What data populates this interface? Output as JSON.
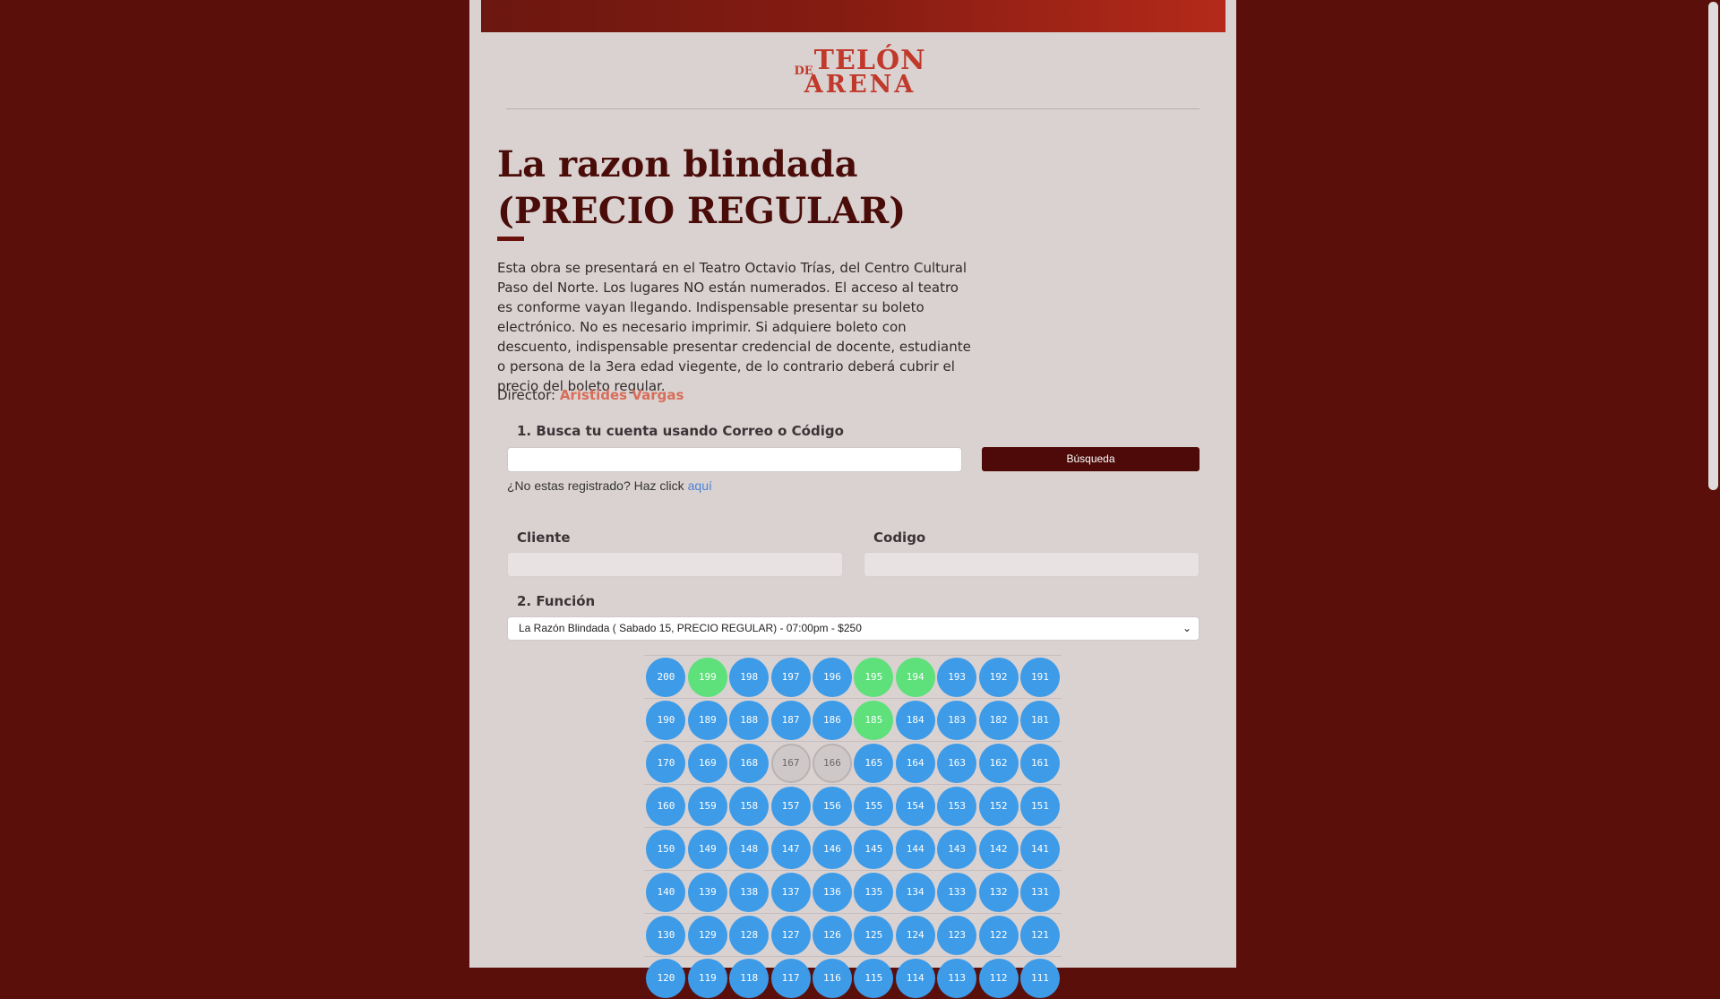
{
  "logo": {
    "de": "DE",
    "telon": "TELÓN",
    "arena": "ARENA"
  },
  "event": {
    "title": "La razon blindada (PRECIO REGULAR)",
    "description": "Esta obra se presentará en el Teatro Octavio Trías, del Centro Cultural Paso del Norte. Los lugares NO están numerados. El acceso al teatro es conforme vayan llegando. Indispensable presentar su boleto electrónico. No es necesario imprimir. Si adquiere boleto con descuento, indispensable presentar credencial de docente, estudiante o persona de la 3era edad viegente, de lo contrario deberá cubrir el precio del boleto regular.",
    "director_label": "Director:",
    "director_name": "Aristides Vargas"
  },
  "search": {
    "label": "1. Busca tu cuenta usando Correo o Código",
    "input_value": "",
    "button_label": "Búsqueda",
    "register_text": "¿No estas registrado? Haz click",
    "register_link": "aquí"
  },
  "client": {
    "cliente_label": "Cliente",
    "cliente_value": "",
    "codigo_label": "Codigo",
    "codigo_value": ""
  },
  "funcion": {
    "label": "2. Función",
    "selected": "La Razón Blindada ( Sabado 15, PRECIO REGULAR) - 07:00pm - $250"
  },
  "seat_legend_colors": {
    "available": "#3d9be8",
    "selected": "#5ee07a",
    "unavailable": "#cfc8c8"
  },
  "seats": {
    "rows": [
      [
        "200",
        "199",
        "198",
        "197",
        "196",
        "195",
        "194",
        "193",
        "192",
        "191"
      ],
      [
        "190",
        "189",
        "188",
        "187",
        "186",
        "185",
        "184",
        "183",
        "182",
        "181"
      ],
      [
        "170",
        "169",
        "168",
        "167",
        "166",
        "165",
        "164",
        "163",
        "162",
        "161"
      ],
      [
        "160",
        "159",
        "158",
        "157",
        "156",
        "155",
        "154",
        "153",
        "152",
        "151"
      ],
      [
        "150",
        "149",
        "148",
        "147",
        "146",
        "145",
        "144",
        "143",
        "142",
        "141"
      ],
      [
        "140",
        "139",
        "138",
        "137",
        "136",
        "135",
        "134",
        "133",
        "132",
        "131"
      ],
      [
        "130",
        "129",
        "128",
        "127",
        "126",
        "125",
        "124",
        "123",
        "122",
        "121"
      ],
      [
        "120",
        "119",
        "118",
        "117",
        "116",
        "115",
        "114",
        "113",
        "112",
        "111"
      ]
    ],
    "selected": [
      "199",
      "195",
      "194",
      "185"
    ],
    "unavailable": [
      "167",
      "166"
    ]
  }
}
